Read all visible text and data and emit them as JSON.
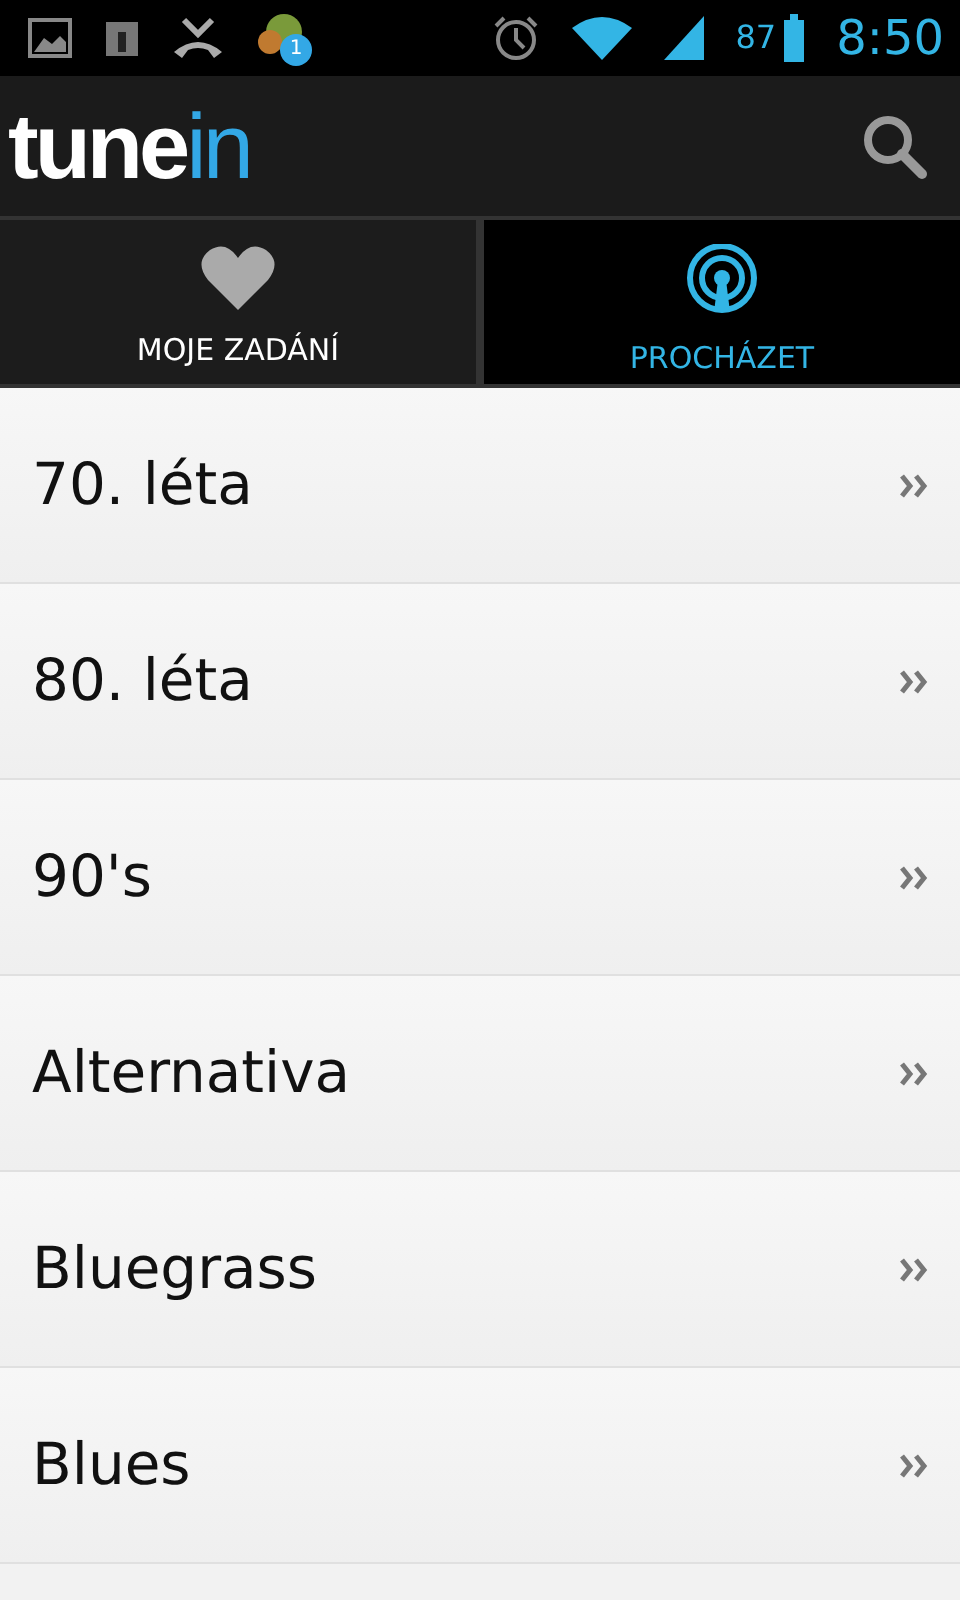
{
  "status_bar": {
    "battery": "87",
    "time": "8:50",
    "notification_badge": "1"
  },
  "app_bar": {
    "logo": [
      "tune",
      "in"
    ]
  },
  "tabs": [
    {
      "label": "MOJE ZADÁNÍ",
      "kind": "favorites",
      "selected": false
    },
    {
      "label": "PROCHÁZET",
      "kind": "browse",
      "selected": true
    }
  ],
  "items": [
    {
      "label": "70. léta"
    },
    {
      "label": "80. léta"
    },
    {
      "label": "90's"
    },
    {
      "label": "Alternativa"
    },
    {
      "label": "Bluegrass"
    },
    {
      "label": "Blues"
    }
  ]
}
